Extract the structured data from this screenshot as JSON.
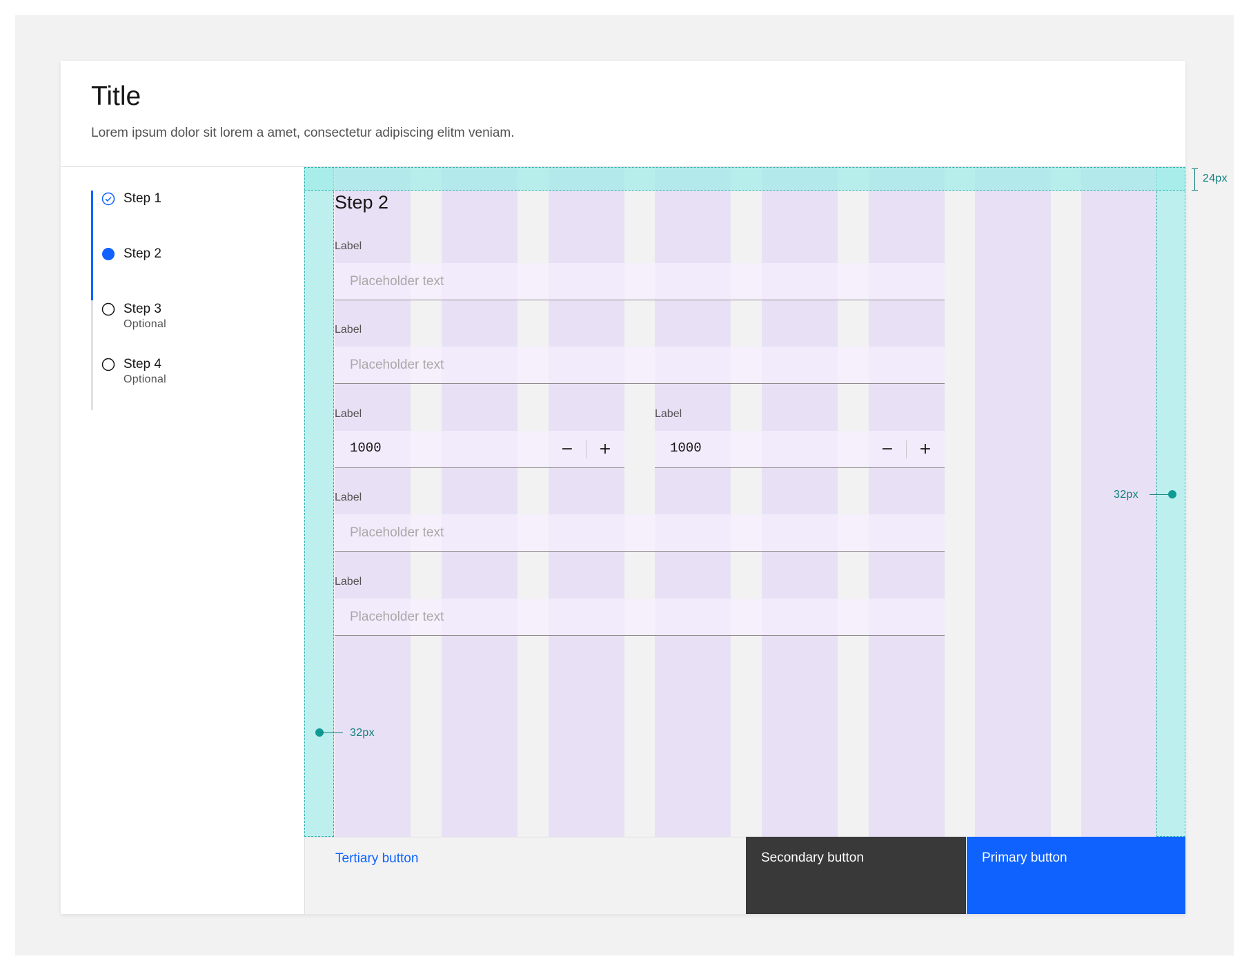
{
  "header": {
    "title": "Title",
    "description": "Lorem ipsum dolor sit lorem a amet, consectetur adipiscing elitm veniam."
  },
  "progress": {
    "steps": [
      {
        "label": "Step 1",
        "sublabel": "",
        "state": "complete"
      },
      {
        "label": "Step 2",
        "sublabel": "",
        "state": "current"
      },
      {
        "label": "Step 3",
        "sublabel": "Optional",
        "state": "incomplete"
      },
      {
        "label": "Step 4",
        "sublabel": "Optional",
        "state": "incomplete"
      }
    ]
  },
  "form": {
    "heading": "Step 2",
    "fields": [
      {
        "label": "Label",
        "placeholder": "Placeholder text",
        "value": ""
      },
      {
        "label": "Label",
        "placeholder": "Placeholder text",
        "value": ""
      },
      {
        "label": "Label",
        "placeholder": "Placeholder text",
        "value": ""
      },
      {
        "label": "Label",
        "placeholder": "Placeholder text",
        "value": ""
      }
    ],
    "number_inputs": [
      {
        "label": "Label",
        "value": "1000",
        "decrement": "−",
        "increment": "+"
      },
      {
        "label": "Label",
        "value": "1000",
        "decrement": "−",
        "increment": "+"
      }
    ]
  },
  "annotations": {
    "top_margin": "24px",
    "right_margin": "32px",
    "left_margin": "32px",
    "color": "#0f9b93"
  },
  "footer": {
    "tertiary_label": "Tertiary button",
    "secondary_label": "Secondary button",
    "primary_label": "Primary button"
  },
  "colors": {
    "accent": "#0f62fe",
    "secondary_button": "#393939",
    "grid_column": "#e8e0f4",
    "margin_overlay": "#beefef"
  },
  "icons": {
    "step_complete": "checkmark-outline-icon",
    "step_current": "circle-filled-icon",
    "step_incomplete": "circle-outline-icon"
  }
}
